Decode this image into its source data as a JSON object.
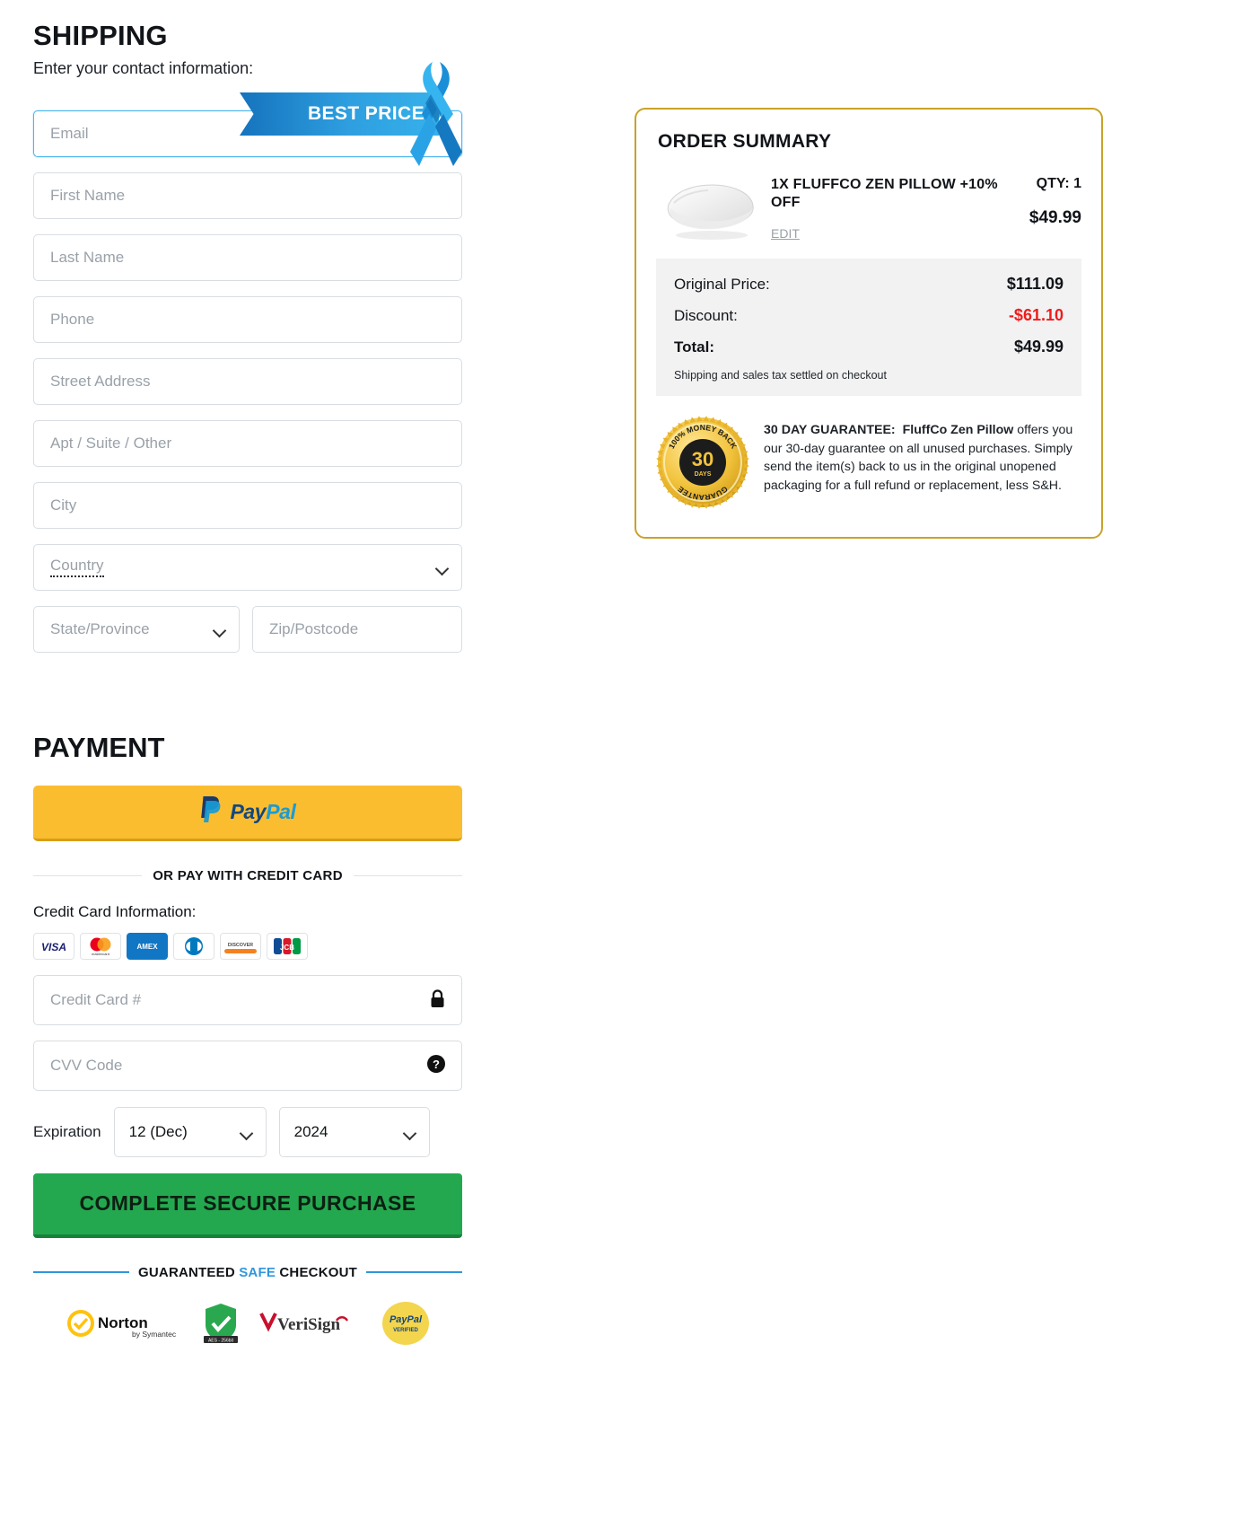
{
  "shipping": {
    "title": "SHIPPING",
    "subtitle": "Enter your contact information:",
    "badge": "BEST PRICE",
    "fields": {
      "email": "Email",
      "first_name": "First Name",
      "last_name": "Last Name",
      "phone": "Phone",
      "street": "Street Address",
      "apt": "Apt / Suite / Other",
      "city": "City",
      "country": "Country",
      "state": "State/Province",
      "zip": "Zip/Postcode"
    }
  },
  "payment": {
    "title": "PAYMENT",
    "paypal": {
      "pay": "Pay",
      "pal": "Pal"
    },
    "or_divider": "OR PAY WITH CREDIT CARD",
    "cc_label": "Credit Card Information:",
    "card_brands": [
      "VISA",
      "mastercard",
      "AMEX",
      "Diners Club",
      "DISCOVER",
      "JCB"
    ],
    "cc_number_placeholder": "Credit Card #",
    "cvv_placeholder": "CVV Code",
    "expiration_label": "Expiration",
    "exp_month": "12 (Dec)",
    "exp_year": "2024",
    "submit_label": "COMPLETE SECURE PURCHASE",
    "safe_checkout": {
      "pre": "GUARANTEED ",
      "mid": "SAFE",
      "post": " CHECKOUT"
    },
    "trust_badges": [
      {
        "name": "Norton",
        "sub": "by Symantec"
      },
      {
        "name": "AES - 256bit"
      },
      {
        "name": "VeriSign"
      },
      {
        "name": "PayPal",
        "sub": "VERIFIED"
      }
    ]
  },
  "order_summary": {
    "title": "ORDER SUMMARY",
    "item": {
      "name": "1X FLUFFCO ZEN PILLOW +10% OFF",
      "edit_label": "EDIT",
      "qty_label": "QTY: 1",
      "price": "$49.99"
    },
    "totals": [
      {
        "label": "Original Price:",
        "value": "$111.09",
        "negative": false,
        "bold": false
      },
      {
        "label": "Discount:",
        "value": "-$61.10",
        "negative": true,
        "bold": false
      },
      {
        "label": "Total:",
        "value": "$49.99",
        "negative": false,
        "bold": true
      }
    ],
    "note": "Shipping and sales tax settled on checkout",
    "guarantee": {
      "seal_top": "100% MONEY BACK",
      "seal_num": "30",
      "seal_days": "DAYS",
      "seal_bottom": "GUARANTEE",
      "heading": "30 DAY GUARANTEE:",
      "brand": "FluffCo Zen Pillow",
      "body": " offers you our 30-day guarantee on all unused purchases. Simply send the item(s) back to us in the original unopened packaging for a full refund or replacement, less S&H."
    }
  },
  "colors": {
    "accent_gold": "#c9a227",
    "paypal_yellow": "#fbbd30",
    "buy_green": "#24a84f",
    "discount_red": "#ef1c1c",
    "ribbon_blue": "#2e9fe0"
  }
}
